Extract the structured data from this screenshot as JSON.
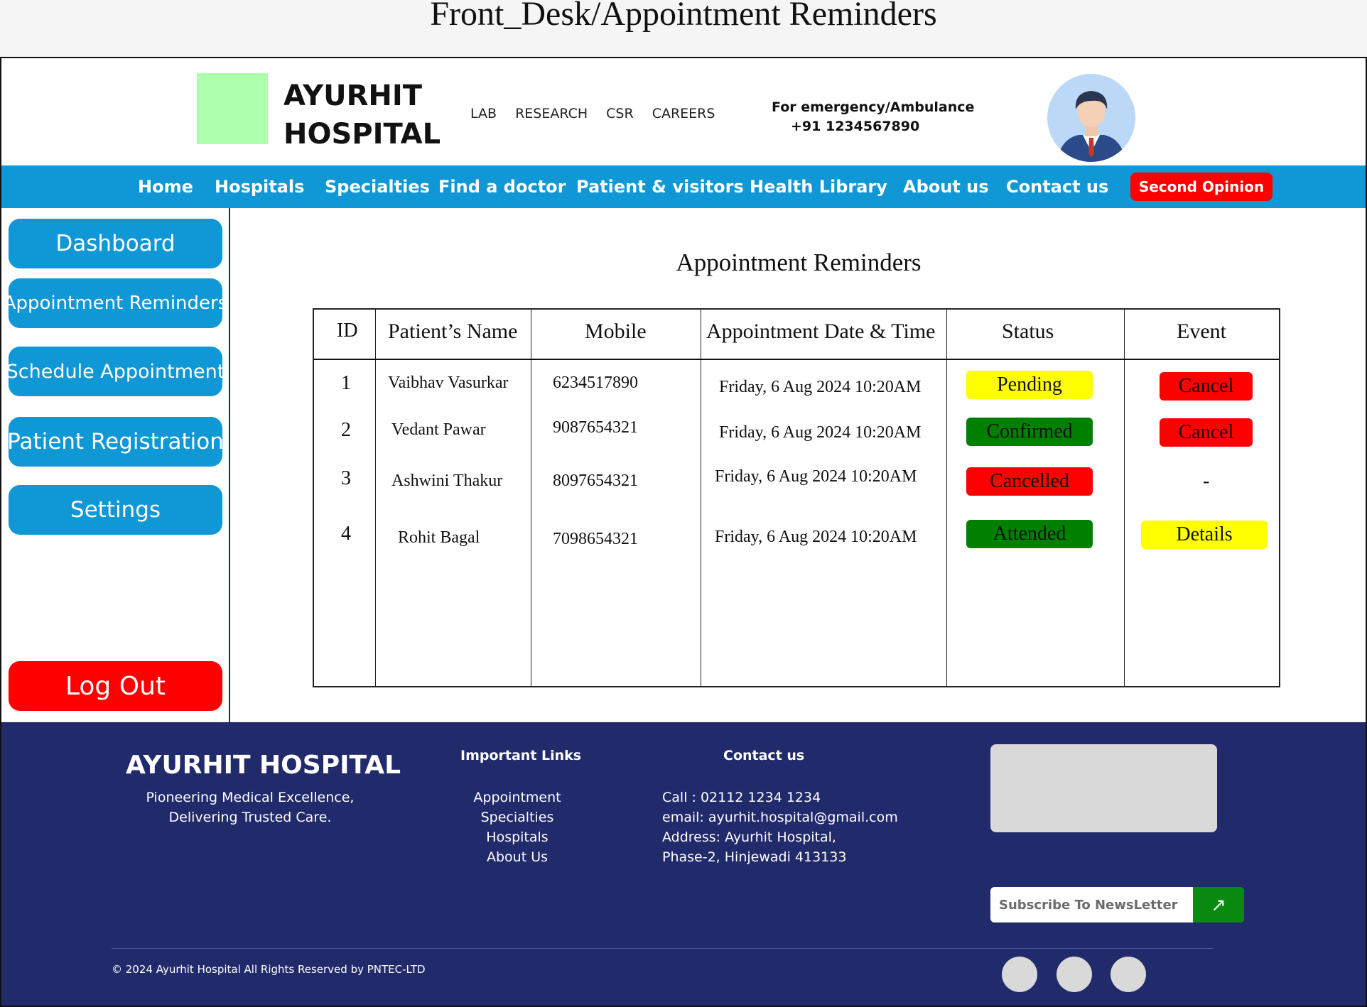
{
  "page_caption": "Front_Desk/Appointment Reminders",
  "header": {
    "brand_line1": "AYURHIT",
    "brand_line2": "HOSPITAL",
    "top_links": [
      "LAB",
      "RESEARCH",
      "CSR",
      "CAREERS"
    ],
    "emergency_label": "For emergency/Ambulance",
    "emergency_phone": "+91 1234567890"
  },
  "nav": {
    "items": [
      "Home",
      "Hospitals",
      "Specialties",
      "Find a doctor",
      "Patient & visitors",
      "Health Library",
      "About us",
      "Contact us"
    ],
    "cta": "Second Opinion"
  },
  "sidebar": {
    "items": [
      "Dashboard",
      "Appointment Reminders",
      "Schedule Appointment",
      "Patient Registration",
      "Settings"
    ],
    "logout": "Log Out"
  },
  "main": {
    "title": "Appointment Reminders",
    "columns": [
      "ID",
      "Patient’s Name",
      "Mobile",
      "Appointment Date & Time",
      "Status",
      "Event"
    ],
    "rows": [
      {
        "id": "1",
        "name": "Vaibhav Vasurkar",
        "mobile": "6234517890",
        "datetime": "Friday, 6 Aug 2024 10:20AM",
        "status": "Pending",
        "event": "Cancel"
      },
      {
        "id": "2",
        "name": "Vedant Pawar",
        "mobile": "9087654321",
        "datetime": "Friday, 6 Aug 2024 10:20AM",
        "status": "Confirmed",
        "event": "Cancel"
      },
      {
        "id": "3",
        "name": "Ashwini Thakur",
        "mobile": "8097654321",
        "datetime": "Friday, 6 Aug 2024 10:20AM",
        "status": "Cancelled",
        "event": "-"
      },
      {
        "id": "4",
        "name": "Rohit Bagal",
        "mobile": "7098654321",
        "datetime": "Friday, 6 Aug 2024 10:20AM",
        "status": "Attended",
        "event": "Details"
      }
    ],
    "colors": {
      "pending": "#ffff00",
      "confirmed": "#008000",
      "cancelled": "#ff0000",
      "attended": "#008000"
    }
  },
  "footer": {
    "brand": "AYURHIT HOSPITAL",
    "tagline1": "Pioneering Medical Excellence,",
    "tagline2": "Delivering Trusted Care.",
    "links_heading": "Important Links",
    "links": [
      "Appointment",
      "Specialties",
      "Hospitals",
      "About Us"
    ],
    "contact_heading": "Contact us",
    "contact": [
      "Call : 02112 1234 1234",
      "email: ayurhit.hospital@gmail.com",
      "Address: Ayurhit Hospital,",
      "Phase-2, Hinjewadi 413133"
    ],
    "subscribe_placeholder": "Subscribe To NewsLetter",
    "subscribe_icon": "arrow-up-right-icon",
    "copyright": "© 2024 Ayurhit Hospital All Rights Reserved by PNTEC-LTD"
  }
}
